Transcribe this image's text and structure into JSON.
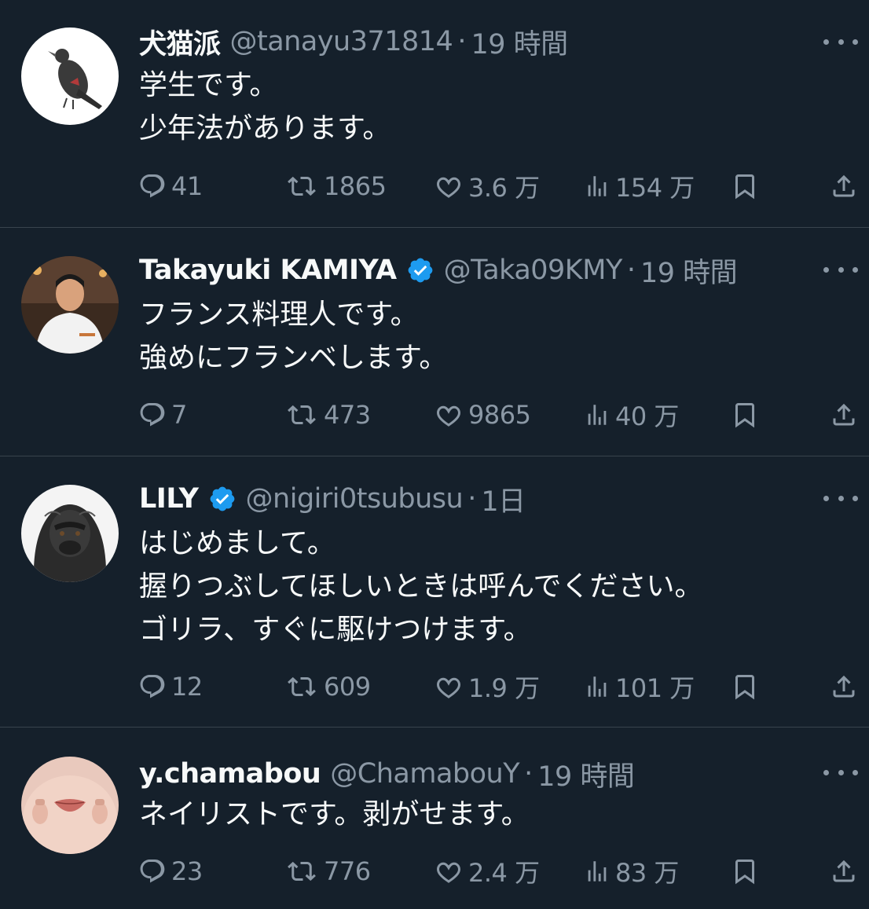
{
  "colors": {
    "background": "#15202b",
    "text": "#f7f9f9",
    "muted": "#8b98a5",
    "divider": "#38444d",
    "verified": "#1d9bf0"
  },
  "icons": {
    "reply": "speech-bubble-icon",
    "retweet": "retweet-icon",
    "like": "heart-icon",
    "views": "bar-chart-icon",
    "bookmark": "bookmark-icon",
    "share": "share-icon",
    "more": "more-dots-icon",
    "verified": "verified-badge-icon"
  },
  "tweets": [
    {
      "name": "犬猫派",
      "handle": "@tanayu371814",
      "separator": "·",
      "time": "19 時間",
      "verified": false,
      "avatar": "crow-avatar",
      "lines": [
        "学生です。",
        "少年法があります。"
      ],
      "replies": "41",
      "retweets": "1865",
      "likes": "3.6 万",
      "views": "154 万"
    },
    {
      "name": "Takayuki KAMIYA",
      "handle": "@Taka09KMY",
      "separator": "·",
      "time": "19 時間",
      "verified": true,
      "avatar": "chef-avatar",
      "lines": [
        "フランス料理人です。",
        "強めにフランベします。"
      ],
      "replies": "7",
      "retweets": "473",
      "likes": "9865",
      "views": "40 万"
    },
    {
      "name": "LILY",
      "handle": "@nigiri0tsubusu",
      "separator": "·",
      "time": "1日",
      "verified": true,
      "avatar": "gorilla-avatar",
      "lines": [
        "はじめまして。",
        "握りつぶしてほしいときは呼んでください。",
        "ゴリラ、すぐに駆けつけます。"
      ],
      "replies": "12",
      "retweets": "609",
      "likes": "1.9 万",
      "views": "101 万"
    },
    {
      "name": "y.chamabou",
      "handle": "@ChamabouY",
      "separator": "·",
      "time": "19 時間",
      "verified": false,
      "avatar": "face-avatar",
      "lines": [
        "ネイリストです。剥がせます。"
      ],
      "replies": "23",
      "retweets": "776",
      "likes": "2.4 万",
      "views": "83 万"
    }
  ]
}
